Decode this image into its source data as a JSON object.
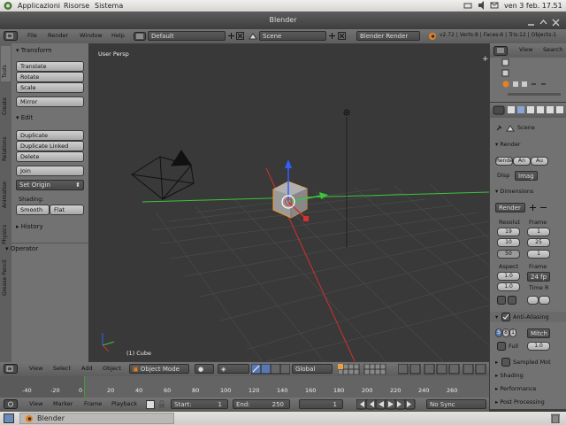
{
  "os_panel": {
    "menu": [
      "Applicazioni",
      "Risorse",
      "Sistema"
    ],
    "clock": "ven  3 feb. 17.51"
  },
  "window": {
    "title": "Blender"
  },
  "info_header": {
    "menus": [
      "File",
      "Render",
      "Window",
      "Help"
    ],
    "screen_layout": "Default",
    "scene": "Scene",
    "engine": "Blender Render",
    "stats": "v2.72 | Verts:8 | Faces:6 | Tris:12 | Objects:1"
  },
  "toolshelf": {
    "tabs": [
      "Tools",
      "Create",
      "Relations",
      "Animation",
      "Physics",
      "Grease Pencil"
    ],
    "transform_header": "Transform",
    "transform_buttons": [
      "Translate",
      "Rotate",
      "Scale",
      "Mirror"
    ],
    "edit_header": "Edit",
    "edit_buttons": [
      "Duplicate",
      "Duplicate Linked",
      "Delete",
      "Join"
    ],
    "set_origin": "Set Origin",
    "shading_label": "Shading:",
    "shading_smooth": "Smooth",
    "shading_flat": "Flat",
    "history_header": "History",
    "operator_header": "Operator"
  },
  "viewport": {
    "view_label": "User Persp",
    "object_label": "(1) Cube"
  },
  "outliner": {
    "view": "View",
    "search": "Search"
  },
  "properties": {
    "scene_label": "Scene",
    "render_header": "Render",
    "render_buttons": [
      "Rende",
      "An",
      "Au"
    ],
    "display_label": "Disp",
    "display_value": "Imag",
    "dimensions_header": "Dimensions",
    "preset": "Render",
    "resolution_label": "Resolut",
    "frame_label": "Frame",
    "res_x": "19",
    "res_y": "10",
    "res_pct": "50",
    "frame_start": "1",
    "frame_end": "25",
    "frame_step": "1",
    "aspect_label": "Aspect",
    "frame_rate_label": "Frame",
    "aspect_x": "1.0",
    "aspect_y": "1.0",
    "fps": "24 fp",
    "time_remap": "Time R",
    "antialias_header": "Anti-Aliasing",
    "aa_samples": [
      "5",
      "8",
      "1"
    ],
    "aa_filter": "Mitch",
    "full_sample": "Full",
    "aa_size": "1.0",
    "sampled_motion": "Sampled Mot",
    "shading_header": "Shading",
    "performance_header": "Performance",
    "post_processing_header": "Post Processing"
  },
  "view3d_header": {
    "menus": [
      "View",
      "Select",
      "Add",
      "Object"
    ],
    "mode": "Object Mode",
    "orientation": "Global"
  },
  "timeline": {
    "ticks": [
      "-40",
      "-20",
      "0",
      "20",
      "40",
      "60",
      "80",
      "100",
      "120",
      "140",
      "160",
      "180",
      "200",
      "220",
      "240",
      "260"
    ],
    "menus": [
      "View",
      "Marker",
      "Frame",
      "Playback"
    ],
    "start_label": "Start:",
    "start_value": "1",
    "end_label": "End:",
    "end_value": "250",
    "current_frame": "1",
    "sync": "No Sync"
  },
  "taskbar": {
    "app": "Blender"
  },
  "colors": {
    "viewport_bg": "#393939",
    "axis_x": "#d43030",
    "axis_y": "#3cc43c",
    "axis_z": "#3060ff",
    "selection": "#ff9a20",
    "playhead": "#3ba03b"
  }
}
